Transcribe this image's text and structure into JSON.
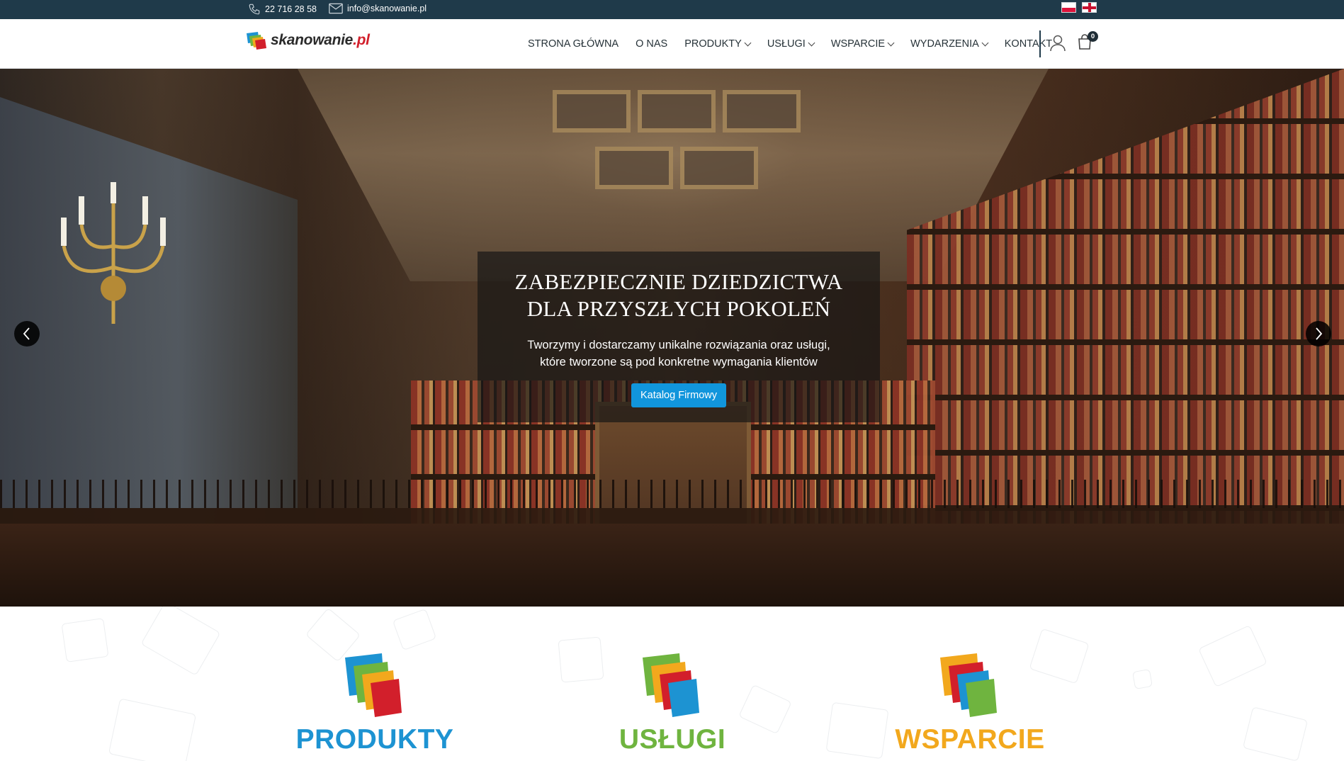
{
  "topbar": {
    "phone": "22 716 28 58",
    "email": "info@skanowanie.pl",
    "languages": [
      "PL",
      "EN"
    ]
  },
  "brand": {
    "name": "skanowanie",
    "tld": ".pl"
  },
  "nav": {
    "items": [
      {
        "label": "STRONA GŁÓWNA",
        "dropdown": false
      },
      {
        "label": "O NAS",
        "dropdown": false
      },
      {
        "label": "PRODUKTY",
        "dropdown": true
      },
      {
        "label": "USŁUGI",
        "dropdown": true
      },
      {
        "label": "WSPARCIE",
        "dropdown": true
      },
      {
        "label": "WYDARZENIA",
        "dropdown": true
      },
      {
        "label": "KONTAKT",
        "dropdown": false
      }
    ],
    "cart_count": "0"
  },
  "hero": {
    "title_line1": "ZABEZPIECZNIE DZIEDZICTWA",
    "title_line2": "DLA PRZYSZŁYCH POKOLEŃ",
    "subtitle_line1": "Tworzymy i dostarczamy unikalne rozwiązania oraz usługi,",
    "subtitle_line2": "które tworzone są pod konkretne wymagania klientów",
    "cta_label": "Katalog Firmowy"
  },
  "features": [
    {
      "title": "PRODUKTY",
      "color": "#1d93d2"
    },
    {
      "title": "USŁUGI",
      "color": "#6fb43f"
    },
    {
      "title": "WSPARCIE",
      "color": "#f2a81d"
    }
  ],
  "colors": {
    "topbar": "#1f3a4a",
    "cta": "#1195dc",
    "logo_accent": "#d21f2b"
  }
}
